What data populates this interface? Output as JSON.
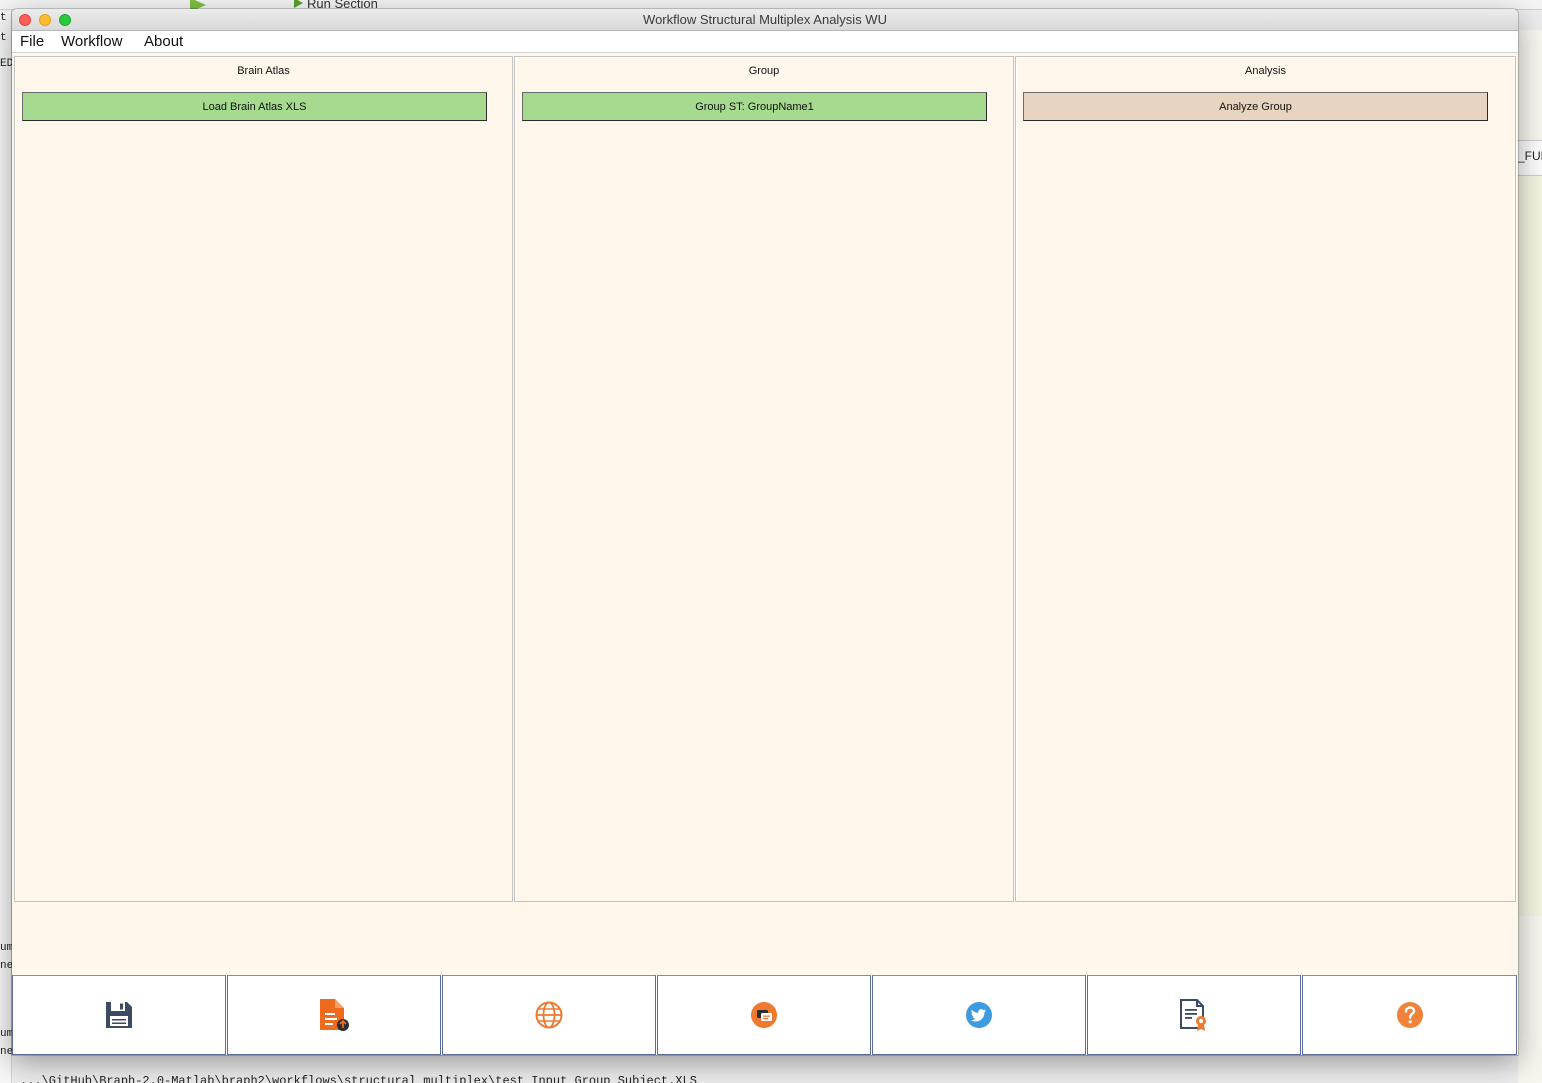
{
  "background": {
    "toolbar_label": "Run Section",
    "right_header_fragment": "_FUN",
    "left_fragments": [
      "t",
      "t",
      "ED",
      "um",
      "ne",
      "um",
      "ne"
    ],
    "cmdline_fragment": "...\\GitHub\\Braph-2.0-Matlab\\braph2\\workflows\\structural_multiplex\\test_Input_Group_Subject.XLS"
  },
  "window": {
    "title": "Workflow Structural Multiplex Analysis WU",
    "menu": [
      "File",
      "Workflow",
      "About"
    ]
  },
  "panels": [
    {
      "title": "Brain Atlas",
      "button_label": "Load Brain Atlas XLS",
      "button_color": "#a6db8f"
    },
    {
      "title": "Group",
      "button_label": "Group ST: GroupName1",
      "button_color": "#a6db8f"
    },
    {
      "title": "Analysis",
      "button_label": "Analyze Group",
      "button_color": "#e7d5c1"
    }
  ],
  "toolbar_icons": [
    {
      "name": "save-icon",
      "color": "#3d4a63"
    },
    {
      "name": "document-icon",
      "color": "#ee6a1f"
    },
    {
      "name": "globe-icon",
      "color": "#ee7a30"
    },
    {
      "name": "forum-icon",
      "color": "#ee7a30"
    },
    {
      "name": "twitter-icon",
      "color": "#3e9be0"
    },
    {
      "name": "license-icon",
      "color": "#3d4a63"
    },
    {
      "name": "help-icon",
      "color": "#f0823a"
    }
  ]
}
